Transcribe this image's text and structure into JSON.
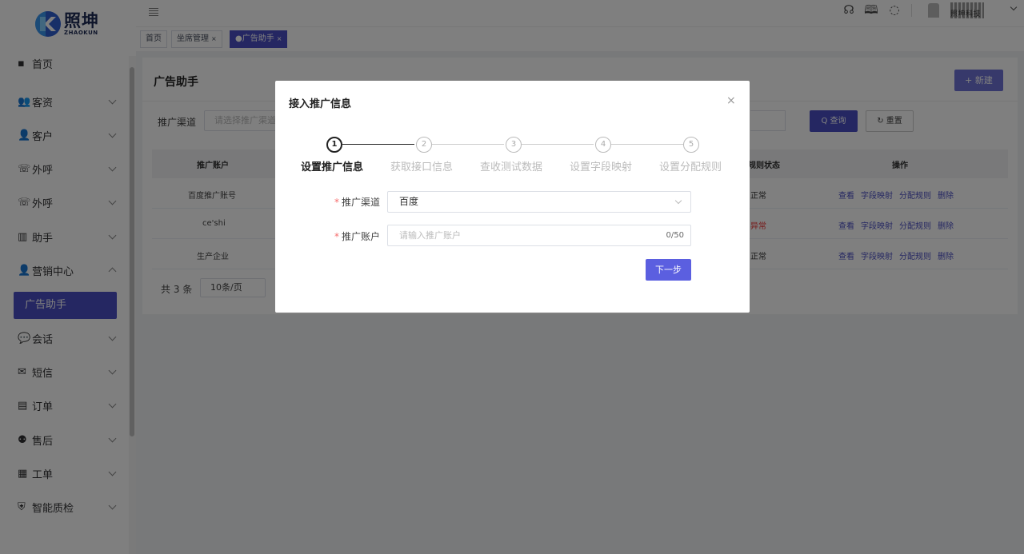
{
  "brand": {
    "name_cn": "照坤",
    "name_en": "ZHAOKUN"
  },
  "sidebar": {
    "top_partial": "首页",
    "items": [
      {
        "label": "客资",
        "icon": "users-icon"
      },
      {
        "label": "客户",
        "icon": "user-icon"
      },
      {
        "label": "外呼",
        "icon": "phone-icon"
      },
      {
        "label": "外呼",
        "icon": "phone-icon"
      },
      {
        "label": "助手",
        "icon": "chart-icon"
      },
      {
        "label": "营销中心",
        "icon": "user-icon",
        "expanded": true
      },
      {
        "label": "会话",
        "icon": "chat-icon"
      },
      {
        "label": "短信",
        "icon": "mail-icon"
      },
      {
        "label": "订单",
        "icon": "document-icon"
      },
      {
        "label": "售后",
        "icon": "service-icon"
      },
      {
        "label": "工单",
        "icon": "ticket-icon"
      },
      {
        "label": "智能质检",
        "icon": "shield-icon"
      }
    ],
    "active_sub": "广告助手"
  },
  "header": {
    "user_name": "照坤科技"
  },
  "tabs": [
    {
      "label": "首页"
    },
    {
      "label": "坐席管理",
      "close": "×"
    },
    {
      "label": "●广告助手",
      "close": "×",
      "active": true
    }
  ],
  "page": {
    "title": "广告助手",
    "new_button": "+ 新建",
    "filter_label": "推广渠道",
    "filter_placeholder": "请选择推广渠道",
    "query_button": "Q 查询",
    "reset_button": "↻ 重置",
    "table": {
      "columns": [
        "推广账户",
        "规则状态",
        "操作"
      ],
      "rows": [
        {
          "account": "百度推广账号",
          "status": "正常",
          "status_type": "normal"
        },
        {
          "account": "ce'shi",
          "status": "异常",
          "status_type": "abnormal"
        },
        {
          "account": "生产企业",
          "status": "正常",
          "status_type": "normal"
        }
      ],
      "actions": [
        "查看",
        "字段映射",
        "分配规则",
        "删除"
      ]
    },
    "pager": {
      "total": "共 3 条",
      "page_size": "10条/页"
    }
  },
  "modal": {
    "title": "接入推广信息",
    "close": "×",
    "steps": [
      {
        "num": "1",
        "label": "设置推广信息",
        "active": true
      },
      {
        "num": "2",
        "label": "获取接口信息"
      },
      {
        "num": "3",
        "label": "查收测试数据"
      },
      {
        "num": "4",
        "label": "设置字段映射"
      },
      {
        "num": "5",
        "label": "设置分配规则"
      }
    ],
    "form": {
      "channel_label": "推广渠道",
      "channel_value": "百度",
      "account_label": "推广账户",
      "account_placeholder": "请输入推广账户",
      "account_counter": "0/50",
      "required_mark": "*"
    },
    "next_button": "下一步"
  },
  "colors": {
    "primary": "#4b4fc4",
    "danger": "#e33333",
    "overlay": "rgba(0,0,0,0.5)"
  }
}
